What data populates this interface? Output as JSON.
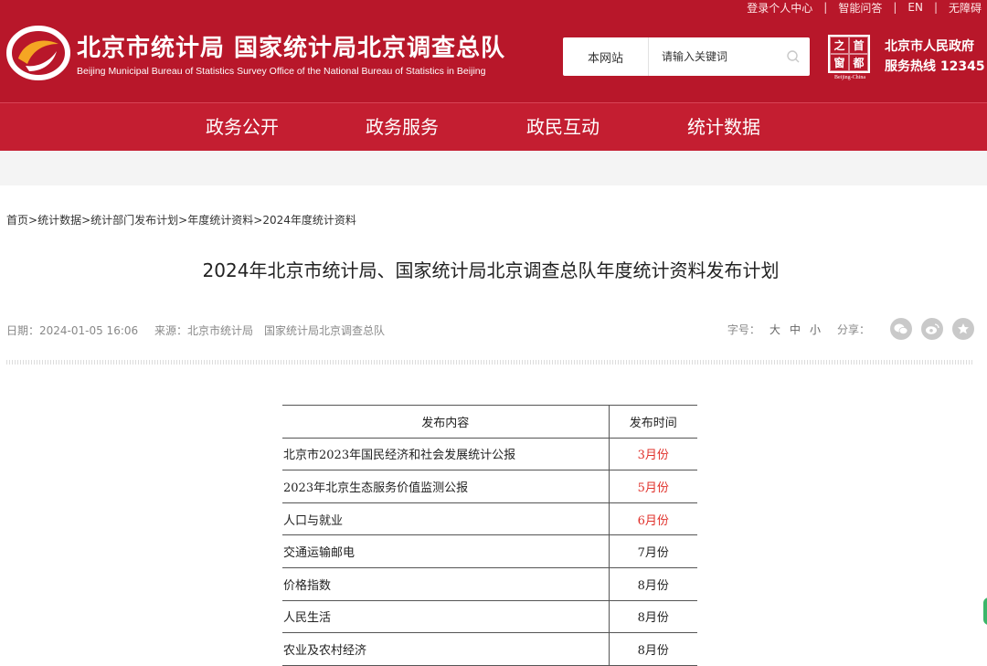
{
  "header": {
    "links": [
      "登录个人中心",
      "智能问答",
      "EN",
      "无障碍"
    ],
    "title": "北京市统计局  国家统计局北京调查总队",
    "subtitle": "Beijing Municipal Bureau of Statistics  Survey Office of the National Bureau of Statistics in Beijing",
    "search": {
      "scope": "本网站",
      "placeholder": "请输入关键词",
      "icon": "search-icon"
    },
    "capital_logo": {
      "chars": [
        "之",
        "首",
        "窗",
        "都"
      ],
      "caption": "Beijing-China"
    },
    "gov": {
      "line1": "北京市人民政府",
      "line2": "服务热线 12345"
    },
    "colors": {
      "brand_red": "#b8172a",
      "nav_red": "#c41e31"
    }
  },
  "nav": {
    "items": [
      "政务公开",
      "政务服务",
      "政民互动",
      "统计数据"
    ]
  },
  "breadcrumb": [
    {
      "text": "首页"
    },
    {
      "text": "统计数据"
    },
    {
      "text": "统计部门发布计划"
    },
    {
      "text": "年度统计资料"
    },
    {
      "text": "2024年度统计资料"
    }
  ],
  "article": {
    "title": "2024年北京市统计局、国家统计局北京调查总队年度统计资料发布计划",
    "date": "日期：2024-01-05 16:06",
    "source": "来源：北京市统计局　国家统计局北京调查总队",
    "font_label": "字号：",
    "font_sizes": [
      "大",
      "中",
      "小"
    ],
    "share_label": "分享：",
    "share_icons": [
      "wechat-icon",
      "weibo-icon",
      "star-icon"
    ]
  },
  "table": {
    "headers": [
      "发布内容",
      "发布时间"
    ],
    "rows": [
      {
        "content": "北京市2023年国民经济和社会发展统计公报",
        "time": "3月份",
        "highlight": true
      },
      {
        "content": "2023年北京生态服务价值监测公报",
        "time": "5月份",
        "highlight": true
      },
      {
        "content": "人口与就业",
        "time": "6月份",
        "highlight": true
      },
      {
        "content": "交通运输邮电",
        "time": "7月份",
        "highlight": false
      },
      {
        "content": "价格指数",
        "time": "8月份",
        "highlight": false
      },
      {
        "content": "人民生活",
        "time": "8月份",
        "highlight": false
      },
      {
        "content": "农业及农村经济",
        "time": "8月份",
        "highlight": false
      }
    ],
    "highlight_color": "#e0302a"
  }
}
